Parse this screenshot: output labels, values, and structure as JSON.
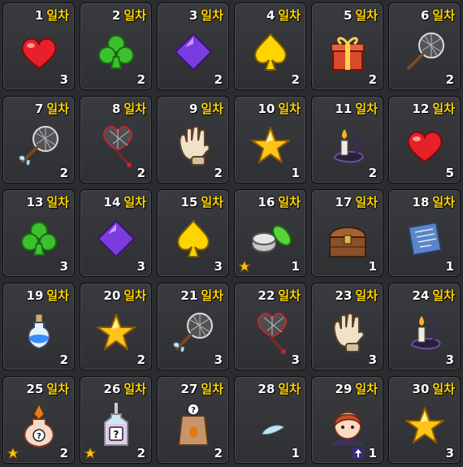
{
  "day_suffix": "일차",
  "days": [
    {
      "day": "1",
      "qty": "3",
      "icon": "heart-icon"
    },
    {
      "day": "2",
      "qty": "2",
      "icon": "club-icon"
    },
    {
      "day": "3",
      "qty": "2",
      "icon": "diamond-icon"
    },
    {
      "day": "4",
      "qty": "2",
      "icon": "spade-icon"
    },
    {
      "day": "5",
      "qty": "2",
      "icon": "gift-box-icon"
    },
    {
      "day": "6",
      "qty": "2",
      "icon": "bug-net-icon"
    },
    {
      "day": "7",
      "qty": "2",
      "icon": "winged-bug-net-icon"
    },
    {
      "day": "8",
      "qty": "2",
      "icon": "heart-bug-net-icon"
    },
    {
      "day": "9",
      "qty": "2",
      "icon": "glove-icon"
    },
    {
      "day": "10",
      "qty": "1",
      "icon": "star-icon"
    },
    {
      "day": "11",
      "qty": "2",
      "icon": "candle-icon"
    },
    {
      "day": "12",
      "qty": "5",
      "icon": "heart-icon"
    },
    {
      "day": "13",
      "qty": "3",
      "icon": "club-icon"
    },
    {
      "day": "14",
      "qty": "3",
      "icon": "diamond-icon"
    },
    {
      "day": "15",
      "qty": "3",
      "icon": "spade-icon"
    },
    {
      "day": "16",
      "qty": "1",
      "icon": "tins-icon",
      "star_badge": true
    },
    {
      "day": "17",
      "qty": "1",
      "icon": "treasure-chest-icon"
    },
    {
      "day": "18",
      "qty": "1",
      "icon": "scroll-icon"
    },
    {
      "day": "19",
      "qty": "2",
      "icon": "potion-icon"
    },
    {
      "day": "20",
      "qty": "2",
      "icon": "star-icon"
    },
    {
      "day": "21",
      "qty": "3",
      "icon": "winged-bug-net-icon"
    },
    {
      "day": "22",
      "qty": "3",
      "icon": "heart-bug-net-icon"
    },
    {
      "day": "23",
      "qty": "3",
      "icon": "glove-icon"
    },
    {
      "day": "24",
      "qty": "3",
      "icon": "candle-icon"
    },
    {
      "day": "25",
      "qty": "2",
      "icon": "mystery-elixir-icon",
      "star_badge": true
    },
    {
      "day": "26",
      "qty": "2",
      "icon": "mystery-bottle-icon",
      "star_badge": true
    },
    {
      "day": "27",
      "qty": "2",
      "icon": "mystery-bag-icon"
    },
    {
      "day": "28",
      "qty": "1",
      "icon": "feather-icon"
    },
    {
      "day": "29",
      "qty": "1",
      "icon": "character-portrait-icon",
      "arrow_badge": true
    },
    {
      "day": "30",
      "qty": "3",
      "icon": "star-icon"
    }
  ],
  "colors": {
    "day_suffix": "#ffd500",
    "background": "#2b2c2f",
    "star": "#ffc41a",
    "heart": "#e8202a",
    "club": "#3cc12e",
    "diamond": "#7a3ce0",
    "spade": "#ffd400"
  }
}
